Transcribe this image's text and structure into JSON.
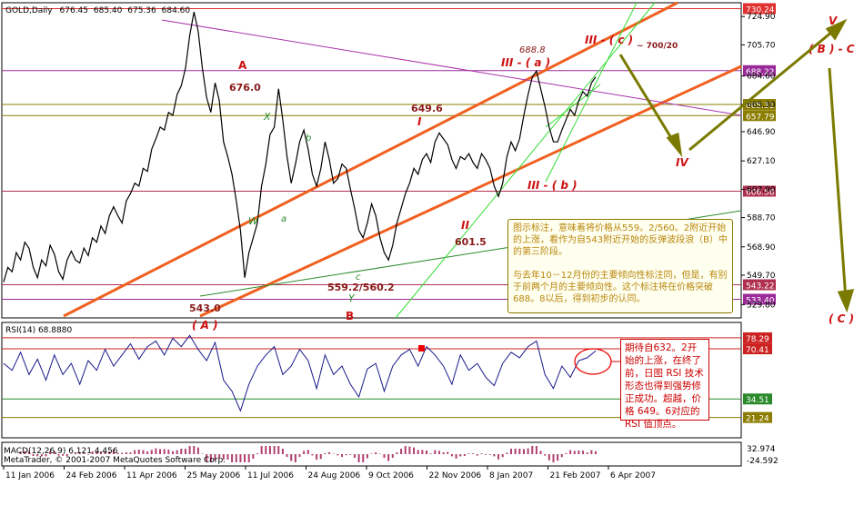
{
  "chart_data": {
    "type": "line",
    "title": "GOLD,Daily",
    "ohlc": [
      "676.45",
      "685.40",
      "675.36",
      "684.60"
    ],
    "x_ticks": [
      "11 Jan 2006",
      "24 Feb 2006",
      "11 Apr 2006",
      "25 May 2006",
      "11 Jul 2006",
      "24 Aug 2006",
      "9 Oct 2006",
      "22 Nov 2006",
      "8 Jan 2007",
      "21 Feb 2007",
      "6 Apr 2007"
    ],
    "price_ticks": [
      "724.90",
      "705.70",
      "684.60",
      "665.30",
      "646.90",
      "627.10",
      "607.90",
      "588.70",
      "568.90",
      "549.70",
      "529.80"
    ],
    "price_ylim": [
      522,
      733
    ],
    "hlines": [
      {
        "value": 730.24,
        "label": "730.24",
        "color": "#e03030"
      },
      {
        "value": 688.22,
        "label": "688.22",
        "color": "#9a2a9a"
      },
      {
        "value": 665.31,
        "label": "665.31",
        "color": "#8b7d00"
      },
      {
        "value": 657.79,
        "label": "657.79",
        "color": "#8b7d00"
      },
      {
        "value": 606.58,
        "label": "606.58",
        "color": "#b03050"
      },
      {
        "value": 543.22,
        "label": "543.22",
        "color": "#b03050"
      },
      {
        "value": 533.4,
        "label": "533.40",
        "color": "#9a2a9a"
      }
    ],
    "price_series": [
      [
        0,
        545
      ],
      [
        3,
        555
      ],
      [
        6,
        552
      ],
      [
        9,
        565
      ],
      [
        12,
        560
      ],
      [
        15,
        572
      ],
      [
        18,
        568
      ],
      [
        21,
        555
      ],
      [
        24,
        548
      ],
      [
        27,
        560
      ],
      [
        30,
        556
      ],
      [
        33,
        570
      ],
      [
        36,
        564
      ],
      [
        39,
        552
      ],
      [
        42,
        547
      ],
      [
        45,
        560
      ],
      [
        48,
        566
      ],
      [
        51,
        560
      ],
      [
        54,
        558
      ],
      [
        57,
        568
      ],
      [
        60,
        563
      ],
      [
        63,
        575
      ],
      [
        66,
        572
      ],
      [
        69,
        583
      ],
      [
        72,
        578
      ],
      [
        75,
        590
      ],
      [
        78,
        596
      ],
      [
        81,
        590
      ],
      [
        84,
        585
      ],
      [
        87,
        600
      ],
      [
        90,
        605
      ],
      [
        93,
        612
      ],
      [
        96,
        610
      ],
      [
        99,
        622
      ],
      [
        102,
        620
      ],
      [
        105,
        635
      ],
      [
        108,
        642
      ],
      [
        111,
        650
      ],
      [
        114,
        648
      ],
      [
        117,
        660
      ],
      [
        120,
        658
      ],
      [
        123,
        672
      ],
      [
        126,
        678
      ],
      [
        129,
        690
      ],
      [
        132,
        712
      ],
      [
        135,
        728
      ],
      [
        138,
        715
      ],
      [
        141,
        690
      ],
      [
        144,
        670
      ],
      [
        147,
        660
      ],
      [
        150,
        680
      ],
      [
        153,
        668
      ],
      [
        156,
        640
      ],
      [
        159,
        630
      ],
      [
        162,
        618
      ],
      [
        165,
        600
      ],
      [
        168,
        580
      ],
      [
        171,
        548
      ],
      [
        174,
        565
      ],
      [
        177,
        575
      ],
      [
        180,
        585
      ],
      [
        183,
        610
      ],
      [
        186,
        625
      ],
      [
        189,
        645
      ],
      [
        192,
        650
      ],
      [
        195,
        676
      ],
      [
        198,
        655
      ],
      [
        201,
        630
      ],
      [
        204,
        612
      ],
      [
        207,
        625
      ],
      [
        210,
        640
      ],
      [
        213,
        648
      ],
      [
        216,
        635
      ],
      [
        219,
        618
      ],
      [
        222,
        610
      ],
      [
        225,
        622
      ],
      [
        228,
        640
      ],
      [
        231,
        628
      ],
      [
        234,
        612
      ],
      [
        237,
        615
      ],
      [
        240,
        625
      ],
      [
        243,
        622
      ],
      [
        246,
        608
      ],
      [
        249,
        595
      ],
      [
        252,
        580
      ],
      [
        255,
        575
      ],
      [
        258,
        585
      ],
      [
        261,
        598
      ],
      [
        264,
        590
      ],
      [
        267,
        575
      ],
      [
        270,
        565
      ],
      [
        273,
        560
      ],
      [
        276,
        570
      ],
      [
        279,
        585
      ],
      [
        282,
        595
      ],
      [
        285,
        605
      ],
      [
        288,
        612
      ],
      [
        291,
        622
      ],
      [
        294,
        618
      ],
      [
        297,
        628
      ],
      [
        300,
        632
      ],
      [
        303,
        626
      ],
      [
        306,
        640
      ],
      [
        309,
        646
      ],
      [
        312,
        642
      ],
      [
        315,
        638
      ],
      [
        318,
        628
      ],
      [
        321,
        622
      ],
      [
        324,
        630
      ],
      [
        327,
        628
      ],
      [
        330,
        632
      ],
      [
        333,
        626
      ],
      [
        336,
        622
      ],
      [
        339,
        632
      ],
      [
        342,
        628
      ],
      [
        345,
        622
      ],
      [
        348,
        610
      ],
      [
        351,
        603
      ],
      [
        354,
        612
      ],
      [
        357,
        630
      ],
      [
        360,
        640
      ],
      [
        363,
        634
      ],
      [
        366,
        642
      ],
      [
        369,
        658
      ],
      [
        372,
        672
      ],
      [
        375,
        684
      ],
      [
        378,
        688
      ],
      [
        381,
        676
      ],
      [
        384,
        664
      ],
      [
        387,
        650
      ],
      [
        390,
        640
      ],
      [
        393,
        640
      ],
      [
        396,
        648
      ],
      [
        399,
        655
      ],
      [
        402,
        662
      ],
      [
        405,
        658
      ],
      [
        408,
        668
      ],
      [
        411,
        674
      ],
      [
        414,
        671
      ],
      [
        417,
        680
      ],
      [
        420,
        684
      ]
    ],
    "rsi_label": "RSI(14) 68.8880",
    "rsi_ticks": [
      "78.29",
      "70.41",
      "34.51",
      "21.24"
    ],
    "rsi_ylim": [
      8,
      88
    ],
    "rsi_series": [
      [
        0,
        60
      ],
      [
        6,
        55
      ],
      [
        12,
        68
      ],
      [
        18,
        52
      ],
      [
        24,
        63
      ],
      [
        30,
        48
      ],
      [
        36,
        66
      ],
      [
        42,
        52
      ],
      [
        48,
        60
      ],
      [
        54,
        45
      ],
      [
        60,
        62
      ],
      [
        66,
        55
      ],
      [
        72,
        70
      ],
      [
        78,
        58
      ],
      [
        84,
        66
      ],
      [
        90,
        74
      ],
      [
        96,
        63
      ],
      [
        102,
        72
      ],
      [
        108,
        76
      ],
      [
        114,
        66
      ],
      [
        120,
        78
      ],
      [
        126,
        72
      ],
      [
        132,
        80
      ],
      [
        138,
        70
      ],
      [
        144,
        62
      ],
      [
        150,
        75
      ],
      [
        156,
        48
      ],
      [
        162,
        40
      ],
      [
        168,
        26
      ],
      [
        174,
        45
      ],
      [
        180,
        58
      ],
      [
        186,
        66
      ],
      [
        192,
        72
      ],
      [
        198,
        52
      ],
      [
        204,
        58
      ],
      [
        210,
        70
      ],
      [
        216,
        62
      ],
      [
        222,
        42
      ],
      [
        228,
        66
      ],
      [
        234,
        52
      ],
      [
        240,
        58
      ],
      [
        246,
        45
      ],
      [
        252,
        36
      ],
      [
        258,
        56
      ],
      [
        264,
        60
      ],
      [
        270,
        40
      ],
      [
        276,
        58
      ],
      [
        282,
        66
      ],
      [
        288,
        70
      ],
      [
        294,
        58
      ],
      [
        300,
        72
      ],
      [
        306,
        66
      ],
      [
        312,
        58
      ],
      [
        318,
        45
      ],
      [
        324,
        66
      ],
      [
        330,
        55
      ],
      [
        336,
        60
      ],
      [
        342,
        50
      ],
      [
        348,
        44
      ],
      [
        354,
        60
      ],
      [
        360,
        68
      ],
      [
        366,
        64
      ],
      [
        372,
        72
      ],
      [
        378,
        76
      ],
      [
        384,
        52
      ],
      [
        390,
        42
      ],
      [
        396,
        58
      ],
      [
        402,
        50
      ],
      [
        408,
        62
      ],
      [
        414,
        64
      ],
      [
        420,
        69
      ]
    ],
    "macd_label": "MACD(12,26,9) 6.121 4.456",
    "macd_ticks": [
      "32.974",
      "-24.592"
    ],
    "copyright": "MetaTrader, © 2001-2007 MetaQuotes Software Corp.",
    "annotations": {
      "p676": "676.0",
      "A": "A",
      "X": "X",
      "b": "b",
      "W": "W",
      "a": "a",
      "p6496": "649.6",
      "I": "I",
      "p6888": "688.8",
      "IIIa": "III - ( a )",
      "IIIc": "III - ( c )",
      "t700": "~ 700/20",
      "IV": "IV",
      "IIIb": "III - ( b )",
      "p6322": "632.2",
      "II": "II",
      "p6015": "601.5",
      "c": "c",
      "p5592": "559.2/560.2",
      "Y": "Y",
      "p543": "543.0",
      "pA": "( A )",
      "B": "B",
      "V": "V",
      "BC": "( B ) - C",
      "pC": "( C )"
    },
    "note1": "图示标注，意味着将价格从559。2/560。2附近开始的上涨，看作为自543附近开始的反弹波段浪（B）中的第三阶段。\n\n与去年10－12月份的主要倾向性标注同，但是，有别于前两个月的主要倾向性。这个标注将在价格突破688。8以后，得到初步的认同。",
    "note2": "期待自632。2开始的上涨，在终了前，日图 RSI 技术形态也得到强势修正成功。超越，价格 649。6对应的 RSI 值顶点。"
  }
}
